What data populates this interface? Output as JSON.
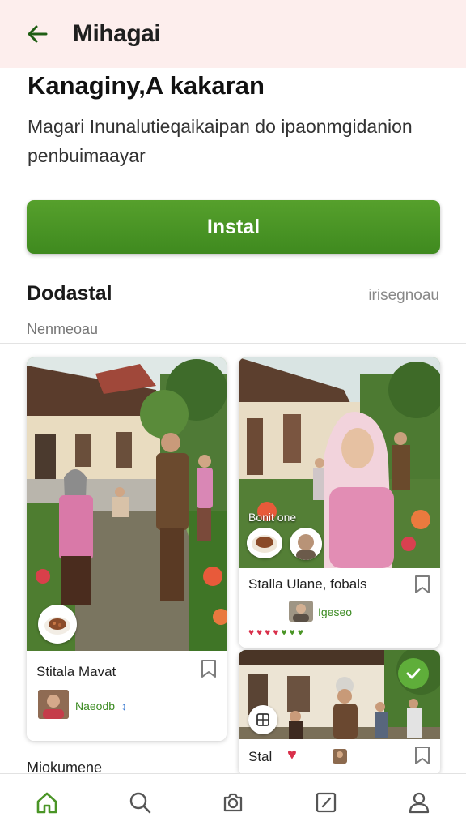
{
  "header": {
    "title": "Mihagai",
    "back_icon": "arrow-left-icon"
  },
  "hero": {
    "headline": "Kanaginy,A kakaran",
    "subtitle": "Magari Inunalutieqaikaipan do ipaonmgidanion penbuimaayar"
  },
  "install_button": {
    "label": "Instal",
    "color": "#4a9526"
  },
  "section": {
    "title": "Dodastal",
    "link": "irisegnoau",
    "subtitle": "Nenmeoau"
  },
  "cards": [
    {
      "name": "Stitala  Mavat",
      "user": "Naeodb",
      "user_badge": "↕"
    },
    {
      "overlay_text": "Bonit one",
      "name": "Stalla  Ulane, fobals",
      "user": "Igeseo",
      "rating_hearts": 7
    },
    {
      "name": "Stal"
    }
  ],
  "partial_section_label": "Miokumene",
  "colors": {
    "accent": "#4a9526",
    "header_bg": "#fdeeed",
    "user_link": "#3c8b22",
    "heart": "#d9304b"
  },
  "bottom_nav": [
    {
      "icon": "home-icon",
      "active": true
    },
    {
      "icon": "search-icon",
      "active": false
    },
    {
      "icon": "camera-icon",
      "active": false
    },
    {
      "icon": "edit-square-icon",
      "active": false
    },
    {
      "icon": "profile-icon",
      "active": false
    }
  ]
}
